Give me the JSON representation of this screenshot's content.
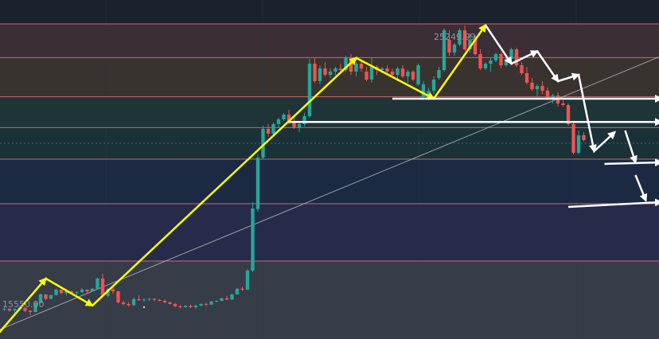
{
  "chart_data": {
    "type": "candlestick",
    "title": "",
    "xlabel": "",
    "ylabel": "",
    "ylim": [
      15400,
      26050
    ],
    "grid": true,
    "labels": {
      "high": "25249.99",
      "low": "15550.00"
    },
    "colors": {
      "up": "#26a69a",
      "down": "#ef5350",
      "zone_line": "#e57373",
      "trend": "#b8bcc4",
      "drawing_yellow": "#ffff00",
      "drawing_white": "#ffffff"
    },
    "zones": [
      {
        "top": 25300,
        "bottom": 24240,
        "fill": "#3c2e36"
      },
      {
        "top": 24240,
        "bottom": 23010,
        "fill": "#38332f"
      },
      {
        "top": 23010,
        "bottom": 22040,
        "fill": "#1f3437"
      },
      {
        "top": 22040,
        "bottom": 21050,
        "fill": "#1a3138"
      },
      {
        "top": 21050,
        "bottom": 19650,
        "fill": "#1b2a42"
      },
      {
        "top": 19650,
        "bottom": 17850,
        "fill": "#252b48"
      },
      {
        "top": 17850,
        "bottom": 15400,
        "fill": "#363c48"
      }
    ],
    "level_lines": [
      25300,
      24240,
      23010,
      22040,
      21050,
      19650,
      17850
    ],
    "dotted_level": 21550,
    "trendline": {
      "from": [
        0,
        15700
      ],
      "to": [
        828,
        24260
      ]
    },
    "candles": [
      [
        1,
        16330,
        16400,
        16280,
        16350
      ],
      [
        2,
        16350,
        16370,
        16250,
        16300
      ],
      [
        3,
        16300,
        16360,
        16220,
        16340
      ],
      [
        4,
        16340,
        16450,
        16330,
        16380
      ],
      [
        5,
        16380,
        16400,
        16240,
        16280
      ],
      [
        6,
        16290,
        16300,
        16150,
        16250
      ],
      [
        7,
        16250,
        16560,
        16230,
        16540
      ],
      [
        8,
        16540,
        16830,
        16520,
        16800
      ],
      [
        9,
        16800,
        16810,
        16620,
        16660
      ],
      [
        10,
        16660,
        16800,
        16650,
        16780
      ],
      [
        11,
        16780,
        16980,
        16770,
        16950
      ],
      [
        12,
        16950,
        16960,
        16810,
        16840
      ],
      [
        13,
        16840,
        16950,
        16770,
        16900
      ],
      [
        14,
        16900,
        16920,
        16820,
        16860
      ],
      [
        15,
        16860,
        16910,
        16780,
        16870
      ],
      [
        16,
        16870,
        17000,
        16850,
        16950
      ],
      [
        17,
        16950,
        16960,
        16850,
        16900
      ],
      [
        18,
        16900,
        17000,
        16880,
        16980
      ],
      [
        19,
        16980,
        17330,
        16960,
        17300
      ],
      [
        20,
        17300,
        17450,
        16710,
        16780
      ],
      [
        21,
        16760,
        17000,
        16700,
        16960
      ],
      [
        22,
        16960,
        17060,
        16820,
        16900
      ],
      [
        23,
        16900,
        16910,
        16520,
        16550
      ],
      [
        24,
        16550,
        16600,
        16460,
        16500
      ],
      [
        25,
        16500,
        16560,
        16420,
        16460
      ],
      [
        26,
        16460,
        16700,
        16440,
        16650
      ],
      [
        27,
        16650,
        16780,
        16600,
        16620
      ],
      [
        28,
        16620,
        16680,
        16560,
        16640
      ],
      [
        29,
        16640,
        16700,
        16600,
        16660
      ],
      [
        30,
        16660,
        16690,
        16580,
        16630
      ],
      [
        31,
        16630,
        16660,
        16580,
        16600
      ],
      [
        32,
        16600,
        16640,
        16520,
        16550
      ],
      [
        33,
        16550,
        16580,
        16480,
        16500
      ],
      [
        34,
        16500,
        16540,
        16400,
        16430
      ],
      [
        35,
        16430,
        16470,
        16360,
        16400
      ],
      [
        36,
        16400,
        16470,
        16380,
        16440
      ],
      [
        37,
        16440,
        16480,
        16370,
        16400
      ],
      [
        38,
        16400,
        16480,
        16360,
        16450
      ],
      [
        39,
        16450,
        16520,
        16430,
        16500
      ],
      [
        40,
        16500,
        16540,
        16440,
        16480
      ],
      [
        41,
        16480,
        16600,
        16470,
        16580
      ],
      [
        42,
        16580,
        16620,
        16550,
        16600
      ],
      [
        43,
        16600,
        16700,
        16580,
        16680
      ],
      [
        44,
        16680,
        16760,
        16620,
        16640
      ],
      [
        45,
        16640,
        16820,
        16630,
        16800
      ],
      [
        46,
        16800,
        17000,
        16790,
        16980
      ],
      [
        47,
        16980,
        17050,
        16900,
        16950
      ],
      [
        48,
        16950,
        17600,
        16940,
        17550
      ],
      [
        49,
        17550,
        19700,
        17500,
        19500
      ],
      [
        50,
        19480,
        21200,
        19400,
        21100
      ],
      [
        51,
        21100,
        22100,
        21050,
        22000
      ],
      [
        52,
        22000,
        22150,
        21750,
        21850
      ],
      [
        53,
        21850,
        22200,
        21780,
        22150
      ],
      [
        54,
        22150,
        22350,
        22050,
        22300
      ],
      [
        55,
        22300,
        22500,
        22250,
        22450
      ],
      [
        56,
        22450,
        22600,
        22150,
        22250
      ],
      [
        57,
        22250,
        22350,
        22000,
        22050
      ],
      [
        58,
        22050,
        22200,
        21900,
        22150
      ],
      [
        59,
        22150,
        22500,
        22080,
        22400
      ],
      [
        60,
        22400,
        24200,
        22350,
        24050
      ],
      [
        61,
        24050,
        24250,
        23450,
        23500
      ],
      [
        62,
        23500,
        24000,
        23400,
        23900
      ],
      [
        63,
        23900,
        24100,
        23650,
        23700
      ],
      [
        64,
        23700,
        23900,
        23600,
        23800
      ],
      [
        65,
        23800,
        23950,
        23700,
        23900
      ],
      [
        66,
        23900,
        24050,
        23750,
        23850
      ],
      [
        67,
        23850,
        24300,
        23800,
        24250
      ],
      [
        68,
        24250,
        24350,
        23700,
        23800
      ],
      [
        69,
        23800,
        24100,
        23650,
        24050
      ],
      [
        70,
        24050,
        24100,
        23800,
        23900
      ],
      [
        71,
        23800,
        23950,
        23500,
        23550
      ],
      [
        72,
        23550,
        24250,
        23450,
        23950
      ],
      [
        73,
        23950,
        24000,
        23700,
        23850
      ],
      [
        74,
        23850,
        23950,
        23750,
        23900
      ],
      [
        75,
        23900,
        24000,
        23700,
        23800
      ],
      [
        76,
        23800,
        23900,
        23600,
        23700
      ],
      [
        77,
        23700,
        23950,
        23500,
        23900
      ],
      [
        78,
        23900,
        24000,
        23600,
        23650
      ],
      [
        79,
        23650,
        23850,
        23450,
        23800
      ],
      [
        80,
        23800,
        23850,
        23500,
        23550
      ],
      [
        81,
        23400,
        24050,
        23350,
        24000
      ],
      [
        82,
        23000,
        23500,
        22950,
        23400
      ],
      [
        83,
        22950,
        23300,
        22900,
        23200
      ],
      [
        84,
        23200,
        23650,
        23100,
        23550
      ],
      [
        85,
        23600,
        23950,
        23550,
        23850
      ],
      [
        86,
        23850,
        25150,
        23800,
        25100
      ],
      [
        87,
        24800,
        25100,
        24300,
        24400
      ],
      [
        88,
        24400,
        24700,
        24300,
        24650
      ],
      [
        89,
        24650,
        25150,
        24600,
        25100
      ],
      [
        90,
        25100,
        25250,
        24450,
        24500
      ],
      [
        91,
        24500,
        25000,
        24400,
        24800
      ],
      [
        92,
        24800,
        24950,
        24300,
        24350
      ],
      [
        93,
        24350,
        24500,
        23850,
        23900
      ],
      [
        94,
        23900,
        24100,
        23850,
        24050
      ],
      [
        95,
        24050,
        24250,
        23800,
        24150
      ],
      [
        96,
        24150,
        24400,
        24100,
        24350
      ],
      [
        97,
        24350,
        24400,
        23900,
        24000
      ],
      [
        98,
        24000,
        24250,
        23950,
        24200
      ],
      [
        99,
        24200,
        24550,
        24150,
        24500
      ],
      [
        100,
        24500,
        24550,
        23950,
        24000
      ],
      [
        101,
        24000,
        24100,
        23700,
        23750
      ],
      [
        102,
        23750,
        23950,
        23400,
        23450
      ],
      [
        103,
        23450,
        23600,
        23200,
        23250
      ],
      [
        104,
        23250,
        23400,
        23000,
        23350
      ],
      [
        105,
        23350,
        23500,
        23100,
        23200
      ],
      [
        106,
        23200,
        23300,
        22900,
        22950
      ],
      [
        107,
        22950,
        23100,
        22800,
        23050
      ],
      [
        108,
        23050,
        23150,
        22700,
        22800
      ],
      [
        109,
        22800,
        22900,
        22700,
        22750
      ],
      [
        110,
        22750,
        22800,
        22100,
        22150
      ],
      [
        111,
        22150,
        22200,
        21200,
        21250
      ],
      [
        112,
        21250,
        21950,
        21200,
        21800
      ],
      [
        113,
        21800,
        21900,
        21600,
        21650
      ]
    ],
    "drawings": {
      "yellow": [
        [
          0,
          15600
        ],
        [
          9,
          17300
        ],
        [
          18,
          16450
        ],
        [
          69,
          24230
        ],
        [
          84,
          22950
        ],
        [
          94,
          25260
        ]
      ],
      "white_zigzag": [
        [
          94,
          25260
        ],
        [
          99,
          24050
        ],
        [
          104,
          24440
        ],
        [
          108,
          23500
        ],
        [
          112,
          23700
        ],
        [
          115,
          21300
        ],
        [
          119,
          21900
        ]
      ],
      "white_arrows": [
        {
          "from": [
            76,
            22950
          ],
          "to": [
            128,
            22950
          ]
        },
        {
          "from": [
            56,
            22220
          ],
          "to": [
            128,
            22220
          ]
        },
        {
          "from": [
            121,
            21950
          ],
          "to": [
            123,
            20950
          ]
        },
        {
          "from": [
            117,
            20900
          ],
          "to": [
            128,
            20950
          ]
        },
        {
          "from": [
            123,
            20550
          ],
          "to": [
            125,
            19750
          ]
        },
        {
          "from": [
            110,
            19550
          ],
          "to": [
            128,
            19700
          ]
        }
      ]
    }
  }
}
